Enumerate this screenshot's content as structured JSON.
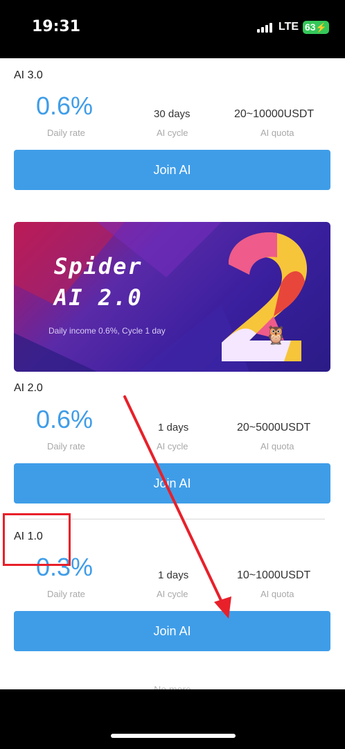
{
  "status_bar": {
    "time": "19:31",
    "network": "LTE",
    "battery": "63"
  },
  "plans": [
    {
      "title": "AI 3.0",
      "rate": "0.6%",
      "rate_label": "Daily rate",
      "cycle": "30 days",
      "cycle_label": "AI cycle",
      "quota": "20~10000USDT",
      "quota_label": "AI quota",
      "button": "Join AI"
    },
    {
      "title": "AI 2.0",
      "rate": "0.6%",
      "rate_label": "Daily rate",
      "cycle": "1 days",
      "cycle_label": "AI cycle",
      "quota": "20~5000USDT",
      "quota_label": "AI quota",
      "button": "Join AI"
    },
    {
      "title": "AI 1.0",
      "rate": "0.3%",
      "rate_label": "Daily rate",
      "cycle": "1 days",
      "cycle_label": "AI cycle",
      "quota": "10~1000USDT",
      "quota_label": "AI quota",
      "button": "Join AI"
    }
  ],
  "banner": {
    "title_line1": "Spider",
    "title_line2": "AI 2.0",
    "subtitle": "Daily income 0.6%, Cycle 1 day",
    "big_numeral": "2"
  },
  "footer": {
    "no_more": "No more"
  },
  "colors": {
    "accent": "#3f9de8",
    "annotation_red": "#e8202a",
    "battery_green": "#35c759"
  }
}
